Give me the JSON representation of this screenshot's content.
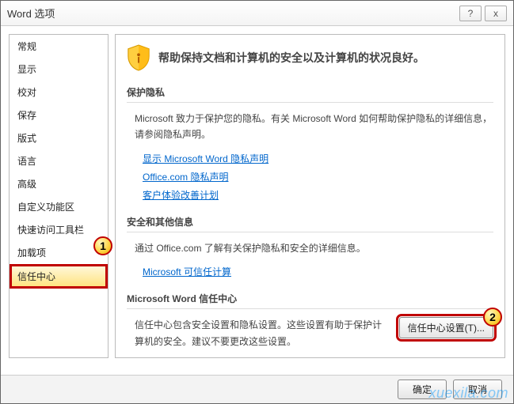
{
  "title": "Word 选项",
  "titlebar": {
    "help": "?",
    "close": "x"
  },
  "sidebar": {
    "items": [
      {
        "label": "常规"
      },
      {
        "label": "显示"
      },
      {
        "label": "校对"
      },
      {
        "label": "保存"
      },
      {
        "label": "版式"
      },
      {
        "label": "语言"
      },
      {
        "label": "高级"
      },
      {
        "label": "自定义功能区"
      },
      {
        "label": "快速访问工具栏"
      },
      {
        "label": "加载项"
      },
      {
        "label": "信任中心",
        "selected": true,
        "highlight": true
      }
    ]
  },
  "hero": {
    "text": "帮助保持文档和计算机的安全以及计算机的状况良好。"
  },
  "privacy": {
    "heading": "保护隐私",
    "text": "Microsoft 致力于保护您的隐私。有关 Microsoft Word 如何帮助保护隐私的详细信息，请参阅隐私声明。",
    "links": [
      "显示 Microsoft Word 隐私声明",
      "Office.com 隐私声明",
      "客户体验改善计划"
    ]
  },
  "security": {
    "heading": "安全和其他信息",
    "text": "通过 Office.com 了解有关保护隐私和安全的详细信息。",
    "links": [
      "Microsoft 可信任计算"
    ]
  },
  "trust": {
    "heading": "Microsoft Word 信任中心",
    "text": "信任中心包含安全设置和隐私设置。这些设置有助于保护计算机的安全。建议不要更改这些设置。",
    "button": "信任中心设置(T)..."
  },
  "footer": {
    "ok": "确定",
    "cancel": "取消"
  },
  "markers": {
    "m1": "1",
    "m2": "2"
  },
  "watermark": "xuexila.com"
}
